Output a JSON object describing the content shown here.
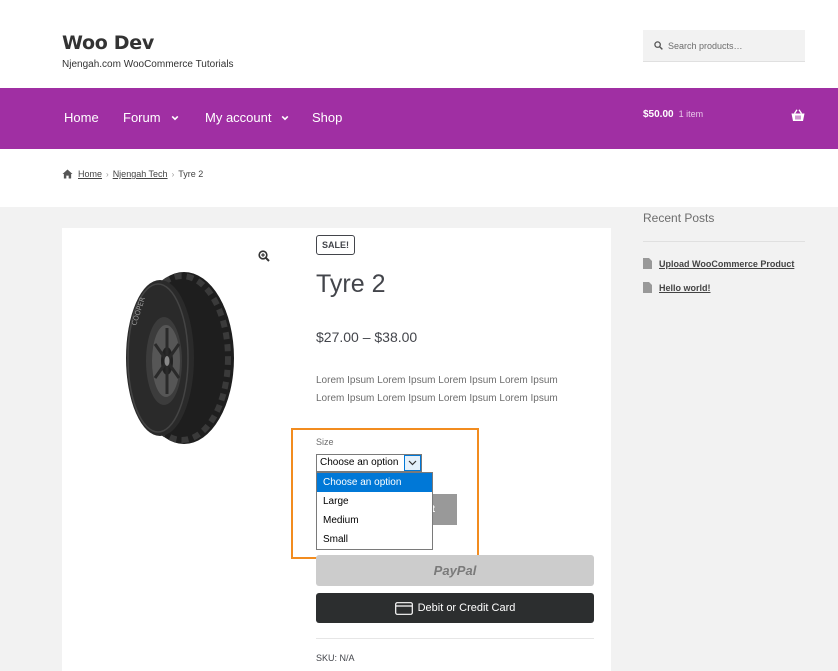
{
  "site": {
    "title": "Woo Dev",
    "tagline": "Njengah.com WooCommerce Tutorials"
  },
  "search": {
    "placeholder": "Search products…"
  },
  "nav": {
    "items": [
      "Home",
      "Forum",
      "My account",
      "Shop"
    ],
    "cart_total": "$50.00",
    "cart_count": "1 item"
  },
  "breadcrumb": {
    "home": "Home",
    "category": "Njengah Tech",
    "current": "Tyre 2"
  },
  "product": {
    "sale_badge": "SALE!",
    "title": "Tyre 2",
    "price": "$27.00 – $38.00",
    "description": "Lorem Ipsum  Lorem Ipsum Lorem Ipsum Lorem Ipsum Lorem Ipsum Lorem Ipsum Lorem Ipsum Lorem Ipsum",
    "size_label": "Size",
    "size_selected": "Choose an option",
    "size_options": [
      "Choose an option",
      "Large",
      "Medium",
      "Small"
    ],
    "add_to_cart_partial": "rt",
    "paypal_label": "PayPal",
    "card_label": "Debit or Credit Card",
    "sku": "SKU: N/A"
  },
  "sidebar": {
    "widget_title": "Recent Posts",
    "posts": [
      "Upload WooCommerce Product",
      "Hello world!"
    ]
  },
  "colors": {
    "nav_purple": "#a02fa3",
    "highlight_orange": "#f28c1f",
    "select_blue": "#0078d7"
  }
}
